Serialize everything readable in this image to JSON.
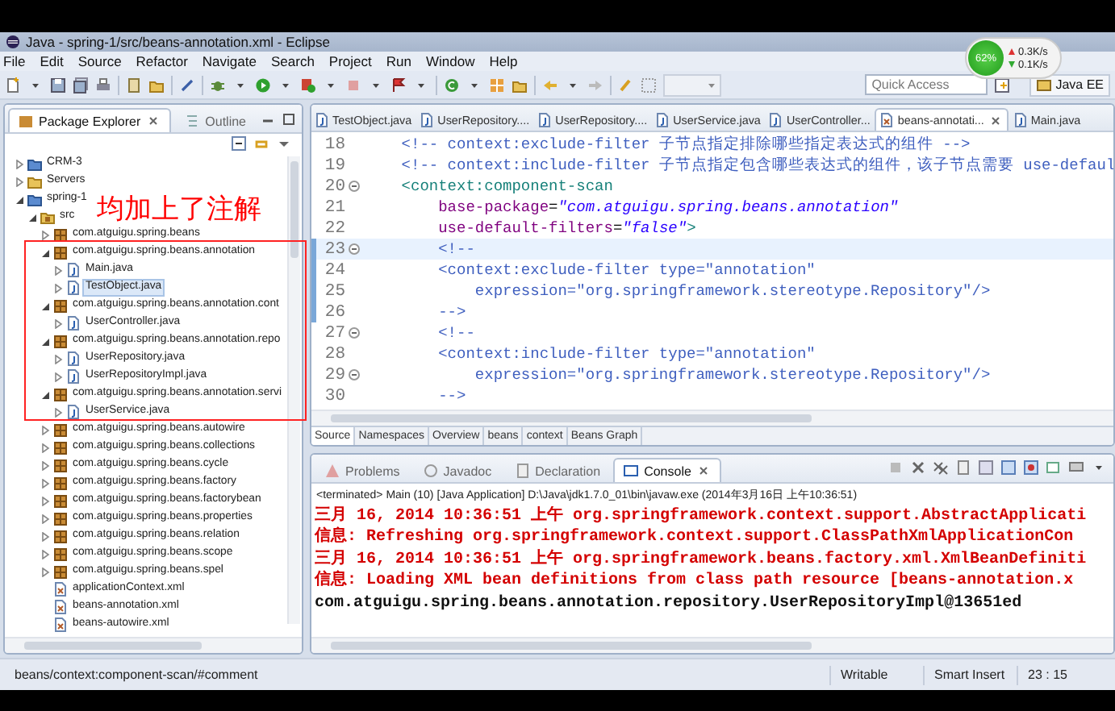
{
  "window": {
    "title": "Java - spring-1/src/beans-annotation.xml - Eclipse"
  },
  "network_meter": {
    "percent": "62%",
    "upload": "0.3K/s",
    "download": "0.1K/s"
  },
  "menu": [
    "File",
    "Edit",
    "Source",
    "Refactor",
    "Navigate",
    "Search",
    "Project",
    "Run",
    "Window",
    "Help"
  ],
  "toolbar": {
    "quick_access": {
      "placeholder": "Quick Access"
    },
    "perspective": "Java EE"
  },
  "package_explorer": {
    "tabs": [
      {
        "label": "Package Explorer",
        "selected": true
      },
      {
        "label": "Outline",
        "selected": false
      }
    ],
    "tree": [
      {
        "label": "CRM-3",
        "kind": "project",
        "expanded": false,
        "selected": false
      },
      {
        "label": "Servers",
        "kind": "folder",
        "expanded": false,
        "selected": false
      },
      {
        "label": "spring-1",
        "kind": "project",
        "expanded": true,
        "selected": false,
        "children": [
          {
            "label": "src",
            "kind": "src",
            "expanded": true,
            "selected": false,
            "children": [
              {
                "label": "com.atguigu.spring.beans",
                "kind": "package",
                "expanded": false,
                "selected": false
              },
              {
                "label": "com.atguigu.spring.beans.annotation",
                "kind": "package",
                "expanded": true,
                "selected": false,
                "children": [
                  {
                    "label": "Main.java",
                    "kind": "java",
                    "expanded": false,
                    "selected": false
                  },
                  {
                    "label": "TestObject.java",
                    "kind": "java",
                    "expanded": false,
                    "selected": true
                  }
                ]
              },
              {
                "label": "com.atguigu.spring.beans.annotation.cont",
                "kind": "package",
                "expanded": true,
                "selected": false,
                "children": [
                  {
                    "label": "UserController.java",
                    "kind": "java",
                    "expanded": false,
                    "selected": false
                  }
                ]
              },
              {
                "label": "com.atguigu.spring.beans.annotation.repo",
                "kind": "package",
                "expanded": true,
                "selected": false,
                "children": [
                  {
                    "label": "UserRepository.java",
                    "kind": "java",
                    "expanded": false,
                    "selected": false
                  },
                  {
                    "label": "UserRepositoryImpl.java",
                    "kind": "java",
                    "expanded": false,
                    "selected": false
                  }
                ]
              },
              {
                "label": "com.atguigu.spring.beans.annotation.servi",
                "kind": "package",
                "expanded": true,
                "selected": false,
                "children": [
                  {
                    "label": "UserService.java",
                    "kind": "java",
                    "expanded": false,
                    "selected": false
                  }
                ]
              },
              {
                "label": "com.atguigu.spring.beans.autowire",
                "kind": "package",
                "expanded": false,
                "selected": false
              },
              {
                "label": "com.atguigu.spring.beans.collections",
                "kind": "package",
                "expanded": false,
                "selected": false
              },
              {
                "label": "com.atguigu.spring.beans.cycle",
                "kind": "package",
                "expanded": false,
                "selected": false
              },
              {
                "label": "com.atguigu.spring.beans.factory",
                "kind": "package",
                "expanded": false,
                "selected": false
              },
              {
                "label": "com.atguigu.spring.beans.factorybean",
                "kind": "package",
                "expanded": false,
                "selected": false
              },
              {
                "label": "com.atguigu.spring.beans.properties",
                "kind": "package",
                "expanded": false,
                "selected": false
              },
              {
                "label": "com.atguigu.spring.beans.relation",
                "kind": "package",
                "expanded": false,
                "selected": false
              },
              {
                "label": "com.atguigu.spring.beans.scope",
                "kind": "package",
                "expanded": false,
                "selected": false
              },
              {
                "label": "com.atguigu.spring.beans.spel",
                "kind": "package",
                "expanded": false,
                "selected": false
              },
              {
                "label": "applicationContext.xml",
                "kind": "xml",
                "selected": false
              },
              {
                "label": "beans-annotation.xml",
                "kind": "xml",
                "selected": false
              },
              {
                "label": "beans-autowire.xml",
                "kind": "xml",
                "selected": false
              }
            ]
          }
        ]
      }
    ]
  },
  "editor": {
    "tabs": [
      {
        "label": "TestObject.java",
        "kind": "java",
        "selected": false
      },
      {
        "label": "UserRepository....",
        "kind": "java",
        "selected": false
      },
      {
        "label": "UserRepository....",
        "kind": "java",
        "selected": false
      },
      {
        "label": "UserService.java",
        "kind": "java",
        "selected": false
      },
      {
        "label": "UserController...",
        "kind": "java",
        "selected": false
      },
      {
        "label": "beans-annotati...",
        "kind": "xml",
        "selected": true
      },
      {
        "label": "Main.java",
        "kind": "java",
        "selected": false
      }
    ],
    "lines": [
      {
        "number": "18",
        "fold": false,
        "current": false,
        "changed": false,
        "segments": [
          {
            "kind": "comment",
            "text": "    <!-- context:exclude-filter 子节点指定排除哪些指定表达式的组件 -->"
          }
        ]
      },
      {
        "number": "19",
        "fold": false,
        "current": false,
        "changed": false,
        "segments": [
          {
            "kind": "comment",
            "text": "    <!-- context:include-filter 子节点指定包含哪些表达式的组件，该子节点需要 use-defaul"
          }
        ]
      },
      {
        "number": "20",
        "fold": true,
        "current": false,
        "changed": false,
        "segments": [
          {
            "kind": "tag",
            "text": "    <context:component-scan"
          }
        ]
      },
      {
        "number": "21",
        "fold": false,
        "current": false,
        "changed": false,
        "segments": [
          {
            "kind": "attr",
            "text": "        base-package"
          },
          {
            "kind": "plain",
            "text": "="
          },
          {
            "kind": "value",
            "text": "\"com.atguigu.spring.beans.annotation\""
          }
        ]
      },
      {
        "number": "22",
        "fold": false,
        "current": false,
        "changed": false,
        "segments": [
          {
            "kind": "attr",
            "text": "        use-default-filters"
          },
          {
            "kind": "plain",
            "text": "="
          },
          {
            "kind": "value",
            "text": "\"false\""
          },
          {
            "kind": "tag",
            "text": ">"
          }
        ]
      },
      {
        "number": "23",
        "fold": true,
        "current": true,
        "changed": true,
        "segments": [
          {
            "kind": "comment",
            "text": "        <!--"
          }
        ]
      },
      {
        "number": "24",
        "fold": false,
        "current": false,
        "changed": true,
        "segments": [
          {
            "kind": "comment",
            "text": "        <context:exclude-filter type=\"annotation\""
          }
        ]
      },
      {
        "number": "25",
        "fold": false,
        "current": false,
        "changed": true,
        "segments": [
          {
            "kind": "comment",
            "text": "            expression=\"org.springframework.stereotype.Repository\"/>"
          }
        ]
      },
      {
        "number": "26",
        "fold": false,
        "current": false,
        "changed": true,
        "segments": [
          {
            "kind": "comment",
            "text": "        -->"
          }
        ]
      },
      {
        "number": "27",
        "fold": true,
        "current": false,
        "changed": false,
        "segments": [
          {
            "kind": "comment",
            "text": "        <!--"
          }
        ]
      },
      {
        "number": "28",
        "fold": false,
        "current": false,
        "changed": false,
        "segments": [
          {
            "kind": "comment",
            "text": "        <context:include-filter type=\"annotation\""
          }
        ]
      },
      {
        "number": "29",
        "fold": true,
        "current": false,
        "changed": false,
        "segments": [
          {
            "kind": "comment",
            "text": "            expression=\"org.springframework.stereotype.Repository\"/>"
          }
        ]
      },
      {
        "number": "30",
        "fold": false,
        "current": false,
        "changed": false,
        "segments": [
          {
            "kind": "comment",
            "text": "        -->"
          }
        ]
      }
    ],
    "bottom_tabs": [
      {
        "label": "Source",
        "selected": true
      },
      {
        "label": "Namespaces",
        "selected": false
      },
      {
        "label": "Overview",
        "selected": false
      },
      {
        "label": "beans",
        "selected": false
      },
      {
        "label": "context",
        "selected": false
      },
      {
        "label": "Beans Graph",
        "selected": false
      }
    ]
  },
  "console": {
    "tabs": [
      {
        "label": "Problems",
        "selected": false
      },
      {
        "label": "Javadoc",
        "selected": false
      },
      {
        "label": "Declaration",
        "selected": false
      },
      {
        "label": "Console",
        "selected": true
      }
    ],
    "header": "<terminated> Main (10) [Java Application] D:\\Java\\jdk1.7.0_01\\bin\\javaw.exe (2014年3月16日 上午10:36:51)",
    "lines": [
      {
        "kind": "stderr",
        "text": "三月 16, 2014 10:36:51 上午 org.springframework.context.support.AbstractApplicati"
      },
      {
        "kind": "stderr",
        "text": "信息: Refreshing org.springframework.context.support.ClassPathXmlApplicationCon"
      },
      {
        "kind": "stderr",
        "text": "三月 16, 2014 10:36:51 上午 org.springframework.beans.factory.xml.XmlBeanDefiniti"
      },
      {
        "kind": "stderr",
        "text": "信息: Loading XML bean definitions from class path resource [beans-annotation.x"
      },
      {
        "kind": "stdout",
        "text": "com.atguigu.spring.beans.annotation.repository.UserRepositoryImpl@13651ed"
      }
    ]
  },
  "status_bar": {
    "path": "beans/context:component-scan/#comment",
    "mode": "Writable",
    "insert": "Smart Insert",
    "position": "23 : 15"
  },
  "annotation": {
    "text": "均加上了注解"
  }
}
